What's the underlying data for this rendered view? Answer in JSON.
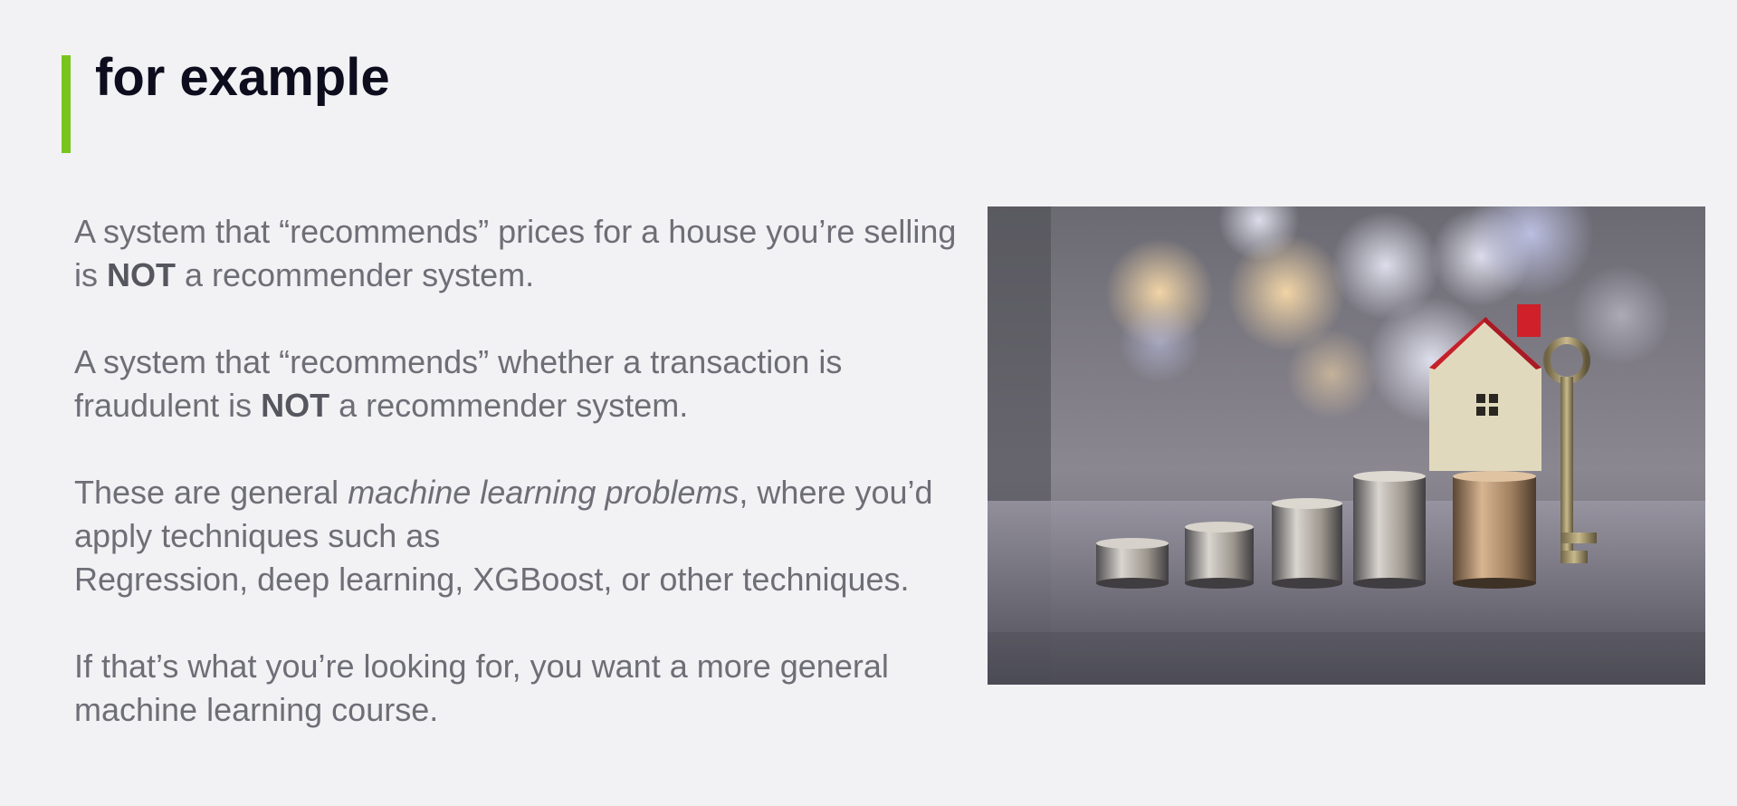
{
  "slide": {
    "title": "for example",
    "paragraphs": [
      {
        "segments": [
          {
            "text": "A system that “recommends” prices for a house you’re selling is ",
            "style": "normal"
          },
          {
            "text": "NOT",
            "style": "bold"
          },
          {
            "text": " a recommender system.",
            "style": "normal"
          }
        ]
      },
      {
        "segments": [
          {
            "text": "A system that “recommends” whether a transaction is fraudulent is ",
            "style": "normal"
          },
          {
            "text": "NOT",
            "style": "bold"
          },
          {
            "text": " a recommender system.",
            "style": "normal"
          }
        ]
      },
      {
        "segments": [
          {
            "text": "These are general ",
            "style": "normal"
          },
          {
            "text": "machine learning problems",
            "style": "italic"
          },
          {
            "text": ", where you’d apply techniques such as",
            "style": "normal"
          },
          {
            "text": "",
            "style": "break"
          },
          {
            "text": "Regression, deep learning, XGBoost, or other techniques.",
            "style": "normal"
          }
        ]
      },
      {
        "segments": [
          {
            "text": "If that’s what you’re looking for, you want a more general machine learning course.",
            "style": "normal"
          }
        ]
      }
    ],
    "image_subject": "house-model-key-and-coin-stacks-photo"
  },
  "colors": {
    "background": "#f2f2f5",
    "accent": "#7ac41f",
    "title": "#0d0d1e",
    "body_text": "#6e6e76"
  }
}
